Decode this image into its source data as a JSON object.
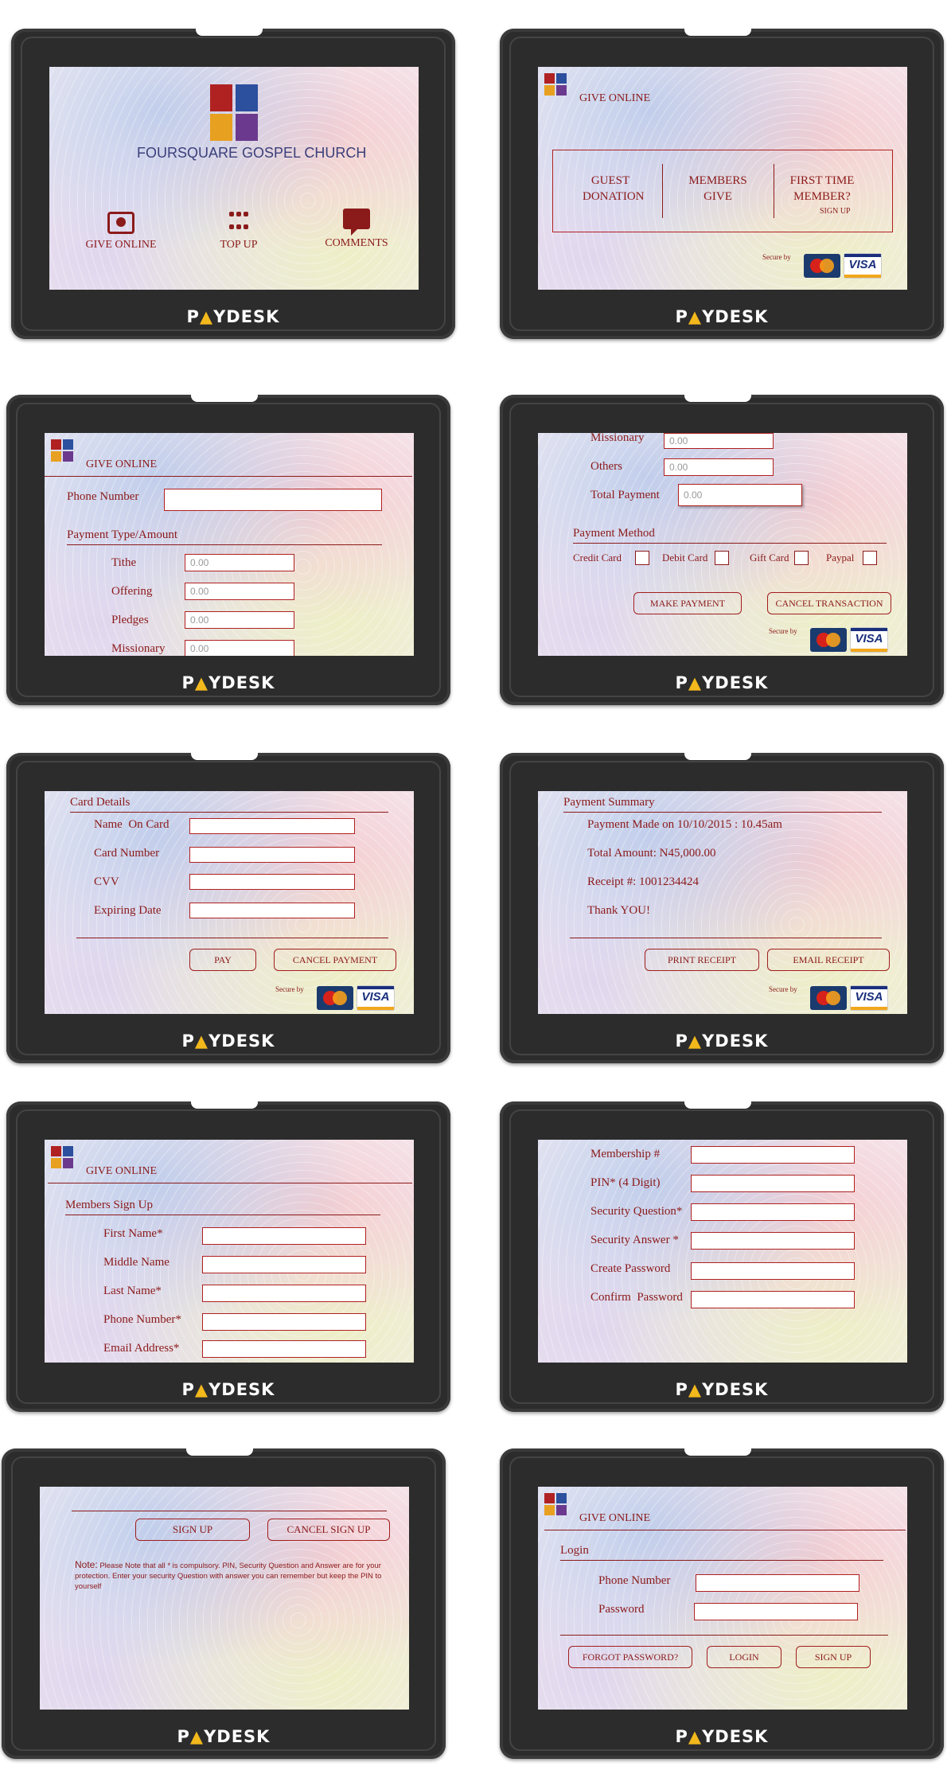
{
  "brand": {
    "pre": "P",
    "tri": "▲",
    "post": "YDESK"
  },
  "common": {
    "give_online": "GIVE ONLINE",
    "secure_by": "Secure by",
    "visa": "VISA",
    "amount_placeholder": "0.00"
  },
  "screen1": {
    "church_name": "FOURSQUARE GOSPEL CHURCH",
    "give_online": "GIVE ONLINE",
    "top_up": "TOP UP",
    "comments": "COMMENTS"
  },
  "screen2": {
    "guest": "GUEST DONATION",
    "members": "MEMBERS GIVE",
    "first_time": "FIRST TIME MEMBER?",
    "sign_up": "SIGN UP"
  },
  "screen3": {
    "phone_number": "Phone Number",
    "payment_type": "Payment Type/Amount",
    "fields": [
      "Tithe",
      "Offering",
      "Pledges",
      "Missionary"
    ]
  },
  "screen4": {
    "fields": [
      "Missionary",
      "Others",
      "Total Payment"
    ],
    "payment_method": "Payment Method",
    "methods": [
      "Credit Card",
      "Debit Card",
      "Gift Card",
      "Paypal"
    ],
    "make_payment": "MAKE PAYMENT",
    "cancel_transaction": "CANCEL TRANSACTION"
  },
  "screen5": {
    "card_details": "Card Details",
    "fields": [
      "Name  On Card",
      "Card Number",
      "CVV",
      "Expiring Date"
    ],
    "pay": "PAY",
    "cancel_payment": "CANCEL PAYMENT"
  },
  "screen6": {
    "payment_summary": "Payment Summary",
    "made_on": "Payment Made on 10/10/2015 : 10.45am",
    "total": "Total Amount: N45,000.00",
    "receipt": "Receipt #: 1001234424",
    "thanks": "Thank YOU!",
    "print_receipt": "PRINT RECEIPT",
    "email_receipt": "EMAIL RECEIPT"
  },
  "screen7": {
    "members_sign_up": "Members Sign Up",
    "fields": [
      "First Name*",
      "Middle Name",
      "Last Name*",
      "Phone Number*",
      "Email Address*"
    ]
  },
  "screen8": {
    "fields": [
      "Membership #",
      "PIN* (4 Digit)",
      "Security Question*",
      "Security Answer *",
      "Create Password",
      "Confirm  Password"
    ]
  },
  "screen9": {
    "sign_up": "SIGN UP",
    "cancel_sign_up": "CANCEL SIGN UP",
    "note_label": "Note:",
    "note_text": "Please Note that all * is compulsory.  PIN, Security Question and Answer are for your protection. Enter your security Question with answer you can remember but keep the PIN to yourself"
  },
  "screen10": {
    "login": "Login",
    "phone_number": "Phone Number",
    "password": "Password",
    "forgot_password": "FORGOT PASSWORD?",
    "login_btn": "LOGIN",
    "sign_up_btn": "SIGN UP"
  }
}
